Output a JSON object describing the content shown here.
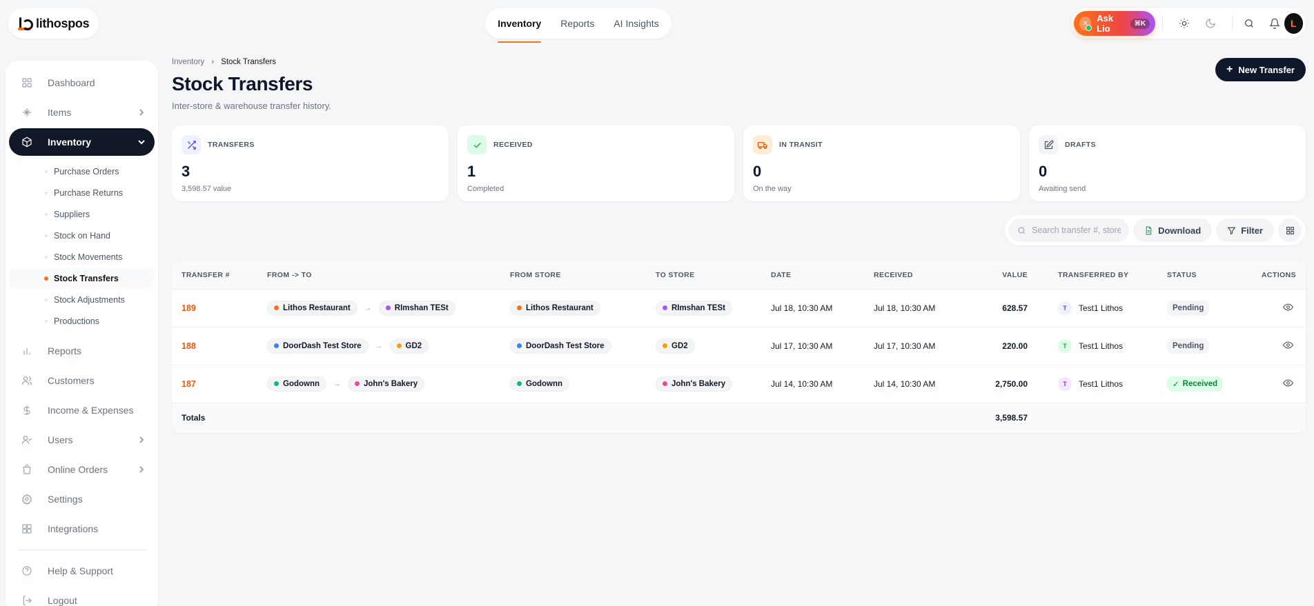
{
  "brand": {
    "name": "lithospos",
    "accent": "#f97316",
    "dark": "#0f172a"
  },
  "topnav": [
    {
      "label": "Inventory",
      "active": true
    },
    {
      "label": "Reports",
      "active": false
    },
    {
      "label": "AI Insights",
      "active": false
    }
  ],
  "topright": {
    "ask_label": "Ask Lio",
    "ask_shortcut": "⌘K",
    "avatar_initial": "L"
  },
  "sidebar": {
    "items": [
      {
        "label": "Dashboard",
        "icon": "grid-icon"
      },
      {
        "label": "Items",
        "icon": "items-icon",
        "chevron": "right"
      },
      {
        "label": "Inventory",
        "icon": "box-icon",
        "chevron": "down",
        "active": true
      },
      {
        "label": "Reports",
        "icon": "bar-chart-icon"
      },
      {
        "label": "Customers",
        "icon": "users-icon"
      },
      {
        "label": "Income & Expenses",
        "icon": "dollar-icon"
      },
      {
        "label": "Users",
        "icon": "user-check-icon",
        "chevron": "right"
      },
      {
        "label": "Online Orders",
        "icon": "bag-icon",
        "chevron": "right"
      },
      {
        "label": "Settings",
        "icon": "gear-icon"
      },
      {
        "label": "Integrations",
        "icon": "integrations-icon"
      },
      {
        "label": "Help & Support",
        "icon": "help-icon"
      },
      {
        "label": "Logout",
        "icon": "logout-icon"
      }
    ],
    "inventory_sub": [
      {
        "label": "Purchase Orders"
      },
      {
        "label": "Purchase Returns"
      },
      {
        "label": "Suppliers"
      },
      {
        "label": "Stock on Hand"
      },
      {
        "label": "Stock Movements"
      },
      {
        "label": "Stock Transfers",
        "active": true
      },
      {
        "label": "Stock Adjustments"
      },
      {
        "label": "Productions"
      }
    ]
  },
  "page": {
    "breadcrumb": [
      "Inventory",
      "Stock Transfers"
    ],
    "title": "Stock Transfers",
    "subtitle": "Inter-store & warehouse transfer history.",
    "new_button": "New Transfer"
  },
  "cards": [
    {
      "label": "TRANSFERS",
      "value": "3",
      "sub": "3,598.57 value",
      "icon": "shuffle-icon",
      "bg": "#eef2ff",
      "stroke": "#4f46e5"
    },
    {
      "label": "RECEIVED",
      "value": "1",
      "sub": "Completed",
      "icon": "check-icon",
      "bg": "#dcfce7",
      "stroke": "#16a34a"
    },
    {
      "label": "IN TRANSIT",
      "value": "0",
      "sub": "On the way",
      "icon": "truck-icon",
      "bg": "#ffedd5",
      "stroke": "#ea580c"
    },
    {
      "label": "DRAFTS",
      "value": "0",
      "sub": "Awaiting send",
      "icon": "edit-icon",
      "bg": "#f3f4f6",
      "stroke": "#4b5563"
    }
  ],
  "toolbar": {
    "search_placeholder": "Search transfer #, store",
    "download_label": "Download",
    "filter_label": "Filter"
  },
  "table": {
    "headers": [
      "TRANSFER #",
      "FROM -> TO",
      "FROM STORE",
      "TO STORE",
      "DATE",
      "RECEIVED",
      "VALUE",
      "TRANSFERRED BY",
      "STATUS",
      "ACTIONS"
    ],
    "rows": [
      {
        "num": "189",
        "from": "Lithos Restaurant",
        "from_color": "#f97316",
        "to": "RImshan TESt",
        "to_color": "#a855f7",
        "date": "Jul 18, 10:30 AM",
        "received": "Jul 18, 10:30 AM",
        "value": "628.57",
        "by": "Test1 Lithos",
        "by_initial": "T",
        "by_bg": "#eef2ff",
        "by_fg": "#4f46e5",
        "status": "Pending"
      },
      {
        "num": "188",
        "from": "DoorDash Test Store",
        "from_color": "#3b82f6",
        "to": "GD2",
        "to_color": "#f59e0b",
        "date": "Jul 17, 10:30 AM",
        "received": "Jul 17, 10:30 AM",
        "value": "220.00",
        "by": "Test1 Lithos",
        "by_initial": "T",
        "by_bg": "#dcfce7",
        "by_fg": "#16a34a",
        "status": "Pending"
      },
      {
        "num": "187",
        "from": "Godownn",
        "from_color": "#10b981",
        "to": "John's Bakery",
        "to_color": "#ec4899",
        "date": "Jul 14, 10:30 AM",
        "received": "Jul 14, 10:30 AM",
        "value": "2,750.00",
        "by": "Test1 Lithos",
        "by_initial": "T",
        "by_bg": "#f3e8ff",
        "by_fg": "#7c3aed",
        "status": "Received"
      }
    ],
    "totals_label": "Totals",
    "totals_value": "3,598.57"
  }
}
